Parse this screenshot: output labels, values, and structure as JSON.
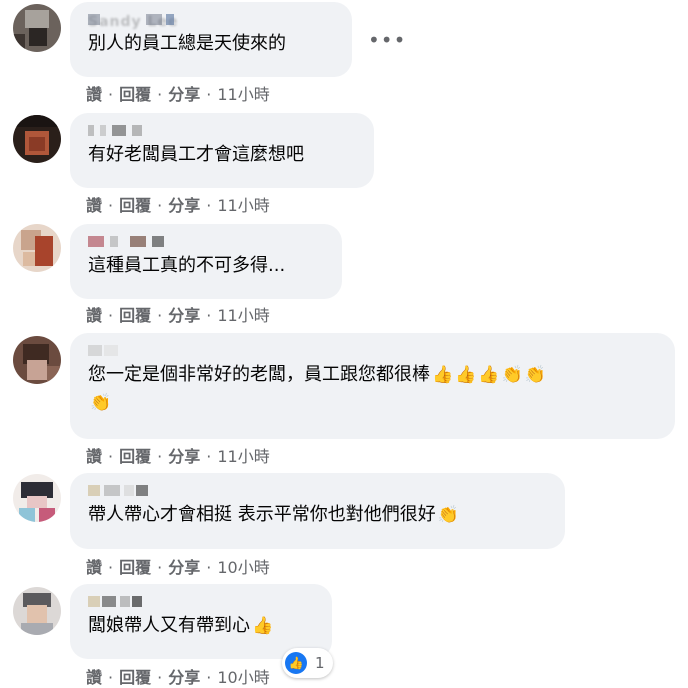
{
  "comments": [
    {
      "name": "Sandy Lee",
      "text": "別人的員工總是天使來的",
      "emojis": [],
      "actions": {
        "like": "讚",
        "reply": "回覆",
        "share": "分享",
        "time": "11小時"
      }
    },
    {
      "name": "",
      "text": "有好老闆員工才會這麼想吧",
      "emojis": [],
      "actions": {
        "like": "讚",
        "reply": "回覆",
        "share": "分享",
        "time": "11小時"
      }
    },
    {
      "name": "",
      "text": "這種員工真的不可多得...",
      "emojis": [],
      "actions": {
        "like": "讚",
        "reply": "回覆",
        "share": "分享",
        "time": "11小時"
      }
    },
    {
      "name": "",
      "text": "您一定是個非常好的老闆，員工跟您都很棒",
      "emojis": [
        "👍",
        "👍",
        "👍",
        "👏",
        "👏",
        "👏"
      ],
      "actions": {
        "like": "讚",
        "reply": "回覆",
        "share": "分享",
        "time": "11小時"
      }
    },
    {
      "name": "",
      "text": "帶人帶心才會相挺 表示平常你也對他們很好",
      "emojis": [
        "👏"
      ],
      "actions": {
        "like": "讚",
        "reply": "回覆",
        "share": "分享",
        "time": "10小時"
      }
    },
    {
      "name": "",
      "text": "闆娘帶人又有帶到心",
      "emojis": [
        "👍"
      ],
      "actions": {
        "like": "讚",
        "reply": "回覆",
        "share": "分享",
        "time": "10小時"
      }
    }
  ],
  "more_menu": "•••",
  "reaction": {
    "icon": "like-icon",
    "count": "1",
    "color": "#1877f2"
  },
  "colors": {
    "bubble": "#f0f2f5",
    "meta": "#65676b",
    "text": "#050505"
  }
}
